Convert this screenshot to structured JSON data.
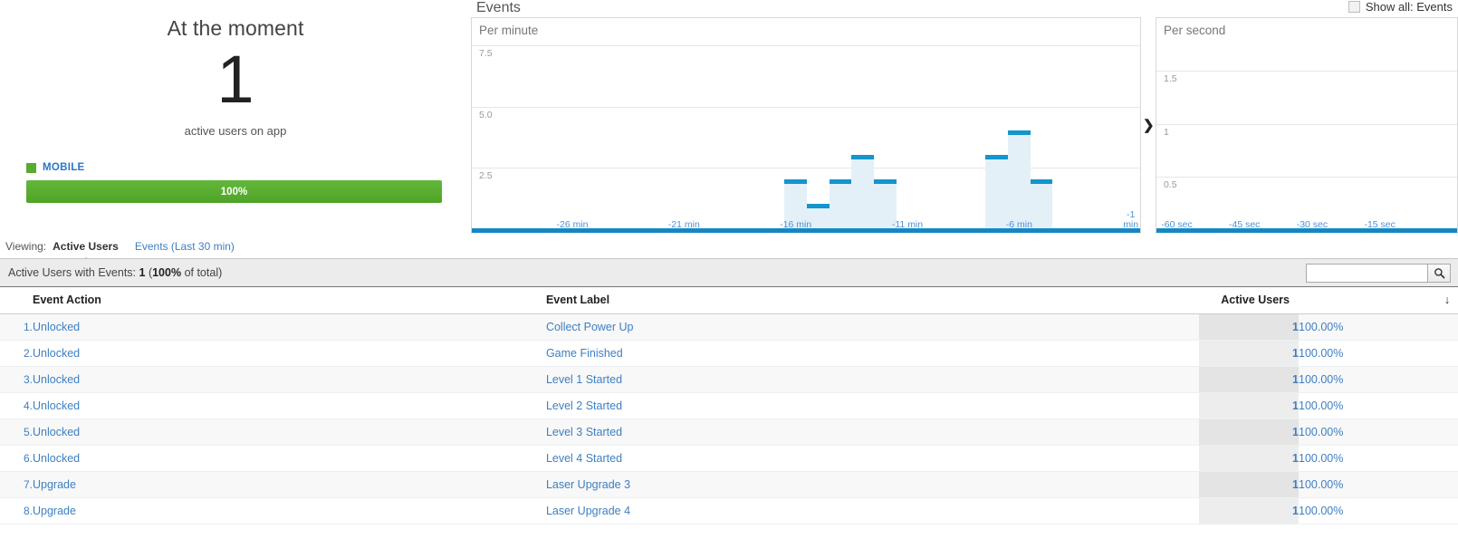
{
  "realtime": {
    "moment": {
      "title": "At the moment",
      "count": "1",
      "subtitle": "active users on app"
    },
    "device_breakdown": [
      {
        "name": "MOBILE",
        "percent_label": "100%",
        "color": "#56ad2d",
        "value": 100
      }
    ]
  },
  "events_panel": {
    "title": "Events",
    "show_all": {
      "label": "Show all: Events",
      "checked": false
    },
    "expand_icon": "❯"
  },
  "viewing": {
    "label": "Viewing:",
    "tabs": [
      {
        "label": "Active Users",
        "active": true
      },
      {
        "label": "Events (Last 30 min)",
        "active": false
      }
    ]
  },
  "summary": {
    "prefix": "Active Users with Events:",
    "count": "1",
    "suffix_open": "(",
    "percent": "100%",
    "suffix_close": " of total)"
  },
  "search": {
    "value": "",
    "placeholder": "",
    "icon": "search-icon"
  },
  "table": {
    "columns": [
      "Event Action",
      "Event Label",
      "Active Users"
    ],
    "sort_indicator": "↓",
    "rows": [
      {
        "num": "1.",
        "action": "Unlocked",
        "label": "Collect Power Up",
        "active_users": "1",
        "percent": "100.00%"
      },
      {
        "num": "2.",
        "action": "Unlocked",
        "label": "Game Finished",
        "active_users": "1",
        "percent": "100.00%"
      },
      {
        "num": "3.",
        "action": "Unlocked",
        "label": "Level 1 Started",
        "active_users": "1",
        "percent": "100.00%"
      },
      {
        "num": "4.",
        "action": "Unlocked",
        "label": "Level 2 Started",
        "active_users": "1",
        "percent": "100.00%"
      },
      {
        "num": "5.",
        "action": "Unlocked",
        "label": "Level 3 Started",
        "active_users": "1",
        "percent": "100.00%"
      },
      {
        "num": "6.",
        "action": "Unlocked",
        "label": "Level 4 Started",
        "active_users": "1",
        "percent": "100.00%"
      },
      {
        "num": "7.",
        "action": "Upgrade",
        "label": "Laser Upgrade 3",
        "active_users": "1",
        "percent": "100.00%"
      },
      {
        "num": "8.",
        "action": "Upgrade",
        "label": "Laser Upgrade 4",
        "active_users": "1",
        "percent": "100.00%"
      }
    ]
  },
  "chart_data": [
    {
      "id": "per-minute",
      "type": "bar",
      "title": "Per minute",
      "xlabel": "",
      "ylabel": "",
      "ylim": [
        0,
        8.6
      ],
      "yticks": [
        2.5,
        5.0,
        7.5
      ],
      "ytick_labels": [
        "2.5",
        "5.0",
        "7.5"
      ],
      "grid": true,
      "x": [
        -30,
        -29,
        -28,
        -27,
        -26,
        -25,
        -24,
        -23,
        -22,
        -21,
        -20,
        -19,
        -18,
        -17,
        -16,
        -15,
        -14,
        -13,
        -12,
        -11,
        -10,
        -9,
        -8,
        -7,
        -6,
        -5,
        -4,
        -3,
        -2,
        -1
      ],
      "xtick_positions": [
        -26,
        -21,
        -16,
        -11,
        -6,
        -1
      ],
      "xtick_labels": [
        "-26 min",
        "-21 min",
        "-16 min",
        "-11 min",
        "-6 min",
        "-1\nmin"
      ],
      "values": [
        0,
        0,
        0,
        0,
        0,
        0,
        0,
        0,
        0,
        0,
        0,
        0,
        0,
        0,
        2,
        1,
        2,
        3,
        2,
        0,
        0,
        0,
        0,
        3,
        4,
        2,
        0,
        0,
        0,
        0
      ],
      "bar_color": "#e3f0f7",
      "cap_color": "#1395cd"
    },
    {
      "id": "per-second",
      "type": "bar",
      "title": "Per second",
      "xlabel": "",
      "ylabel": "",
      "ylim": [
        0,
        2.0
      ],
      "yticks": [
        0.5,
        1.0,
        1.5
      ],
      "ytick_labels": [
        "0.5",
        "1",
        "1.5"
      ],
      "grid": true,
      "xtick_positions": [
        -60,
        -45,
        -30,
        -15
      ],
      "xtick_labels": [
        "-60 sec",
        "-45 sec",
        "-30 sec",
        "-15 sec"
      ],
      "values": [],
      "bar_color": "#e3f0f7",
      "cap_color": "#1395cd"
    }
  ]
}
